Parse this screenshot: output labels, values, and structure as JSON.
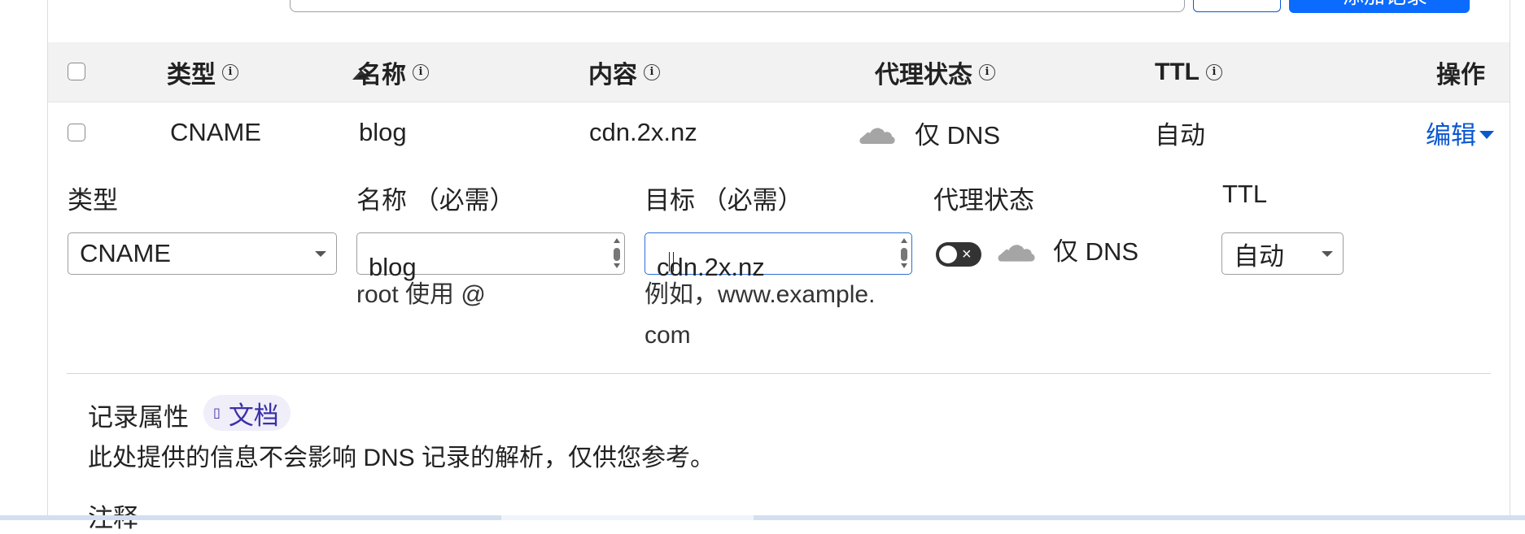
{
  "toolbar": {
    "add_record_label": "添加记录"
  },
  "table": {
    "headers": {
      "type": "类型",
      "name": "名称",
      "content": "内容",
      "proxy": "代理状态",
      "ttl": "TTL",
      "actions": "操作"
    },
    "info_glyph": "i",
    "sort": "type-ascending",
    "row": {
      "type": "CNAME",
      "name": "blog",
      "content": "cdn.2x.nz",
      "proxy_status": "仅 DNS",
      "ttl": "自动",
      "edit_label": "编辑"
    }
  },
  "form": {
    "type_label": "类型",
    "type_value": "CNAME",
    "name_label": "名称 （必需）",
    "name_value": "blog",
    "name_hint": "root 使用 @",
    "target_label": "目标 （必需）",
    "target_value": "cdn.2x.nz",
    "target_hint_line1": "例如，www.example.",
    "target_hint_line2": "com",
    "proxy_label": "代理状态",
    "proxy_toggle": "off",
    "proxy_value": "仅 DNS",
    "ttl_label": "TTL",
    "ttl_value": "自动"
  },
  "attributes": {
    "title": "记录属性",
    "doc_badge": "文档",
    "description": "此处提供的信息不会影响 DNS 记录的解析，仅供您参考。",
    "note_label": "注释"
  },
  "colors": {
    "accent": "#0b57d0",
    "primary_button": "#0b6bff",
    "badge_bg": "#efeef9",
    "header_bg": "#f2f2f2"
  }
}
